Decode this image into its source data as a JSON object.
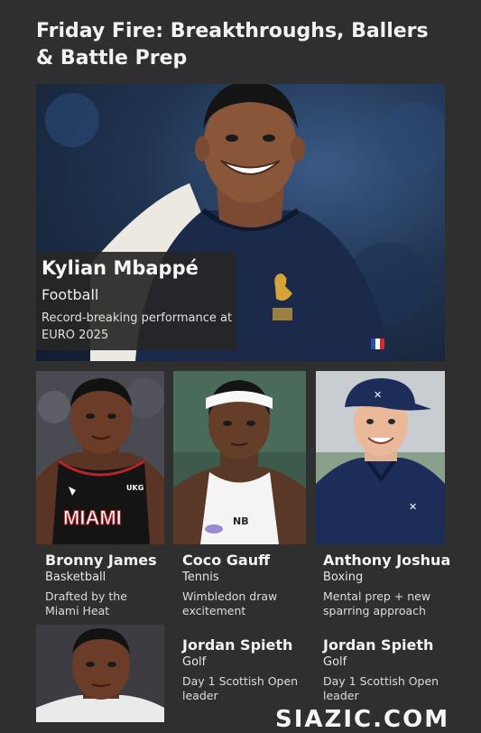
{
  "headline": "Friday Fire: Breakthroughs, Ballers & Battle Prep",
  "hero": {
    "name": "Kylian Mbappé",
    "sport": "Football",
    "note": "Record-breaking performance at EURO 2025",
    "jersey_color": "#1b2a4a"
  },
  "cards": [
    {
      "name": "Bronny James",
      "sport": "Basketball",
      "note": "Drafted by the Miami Heat",
      "jersey_text": "MIAMI",
      "jersey_badge": "UKG"
    },
    {
      "name": "Coco Gauff",
      "sport": "Tennis",
      "note": "Wimbledon draw excitement"
    },
    {
      "name": "Anthony Joshua",
      "sport": "Boxing",
      "note": "Mental prep + new sparring approach"
    },
    {
      "name": "Jordan Spieth",
      "sport": "Golf",
      "note": "Day 1 Scottish Open leader"
    },
    {
      "name": "Jordan Spieth",
      "sport": "Golf",
      "note": "Day 1 Scottish Open leader"
    }
  ],
  "watermark": "SIAZIC.COM"
}
